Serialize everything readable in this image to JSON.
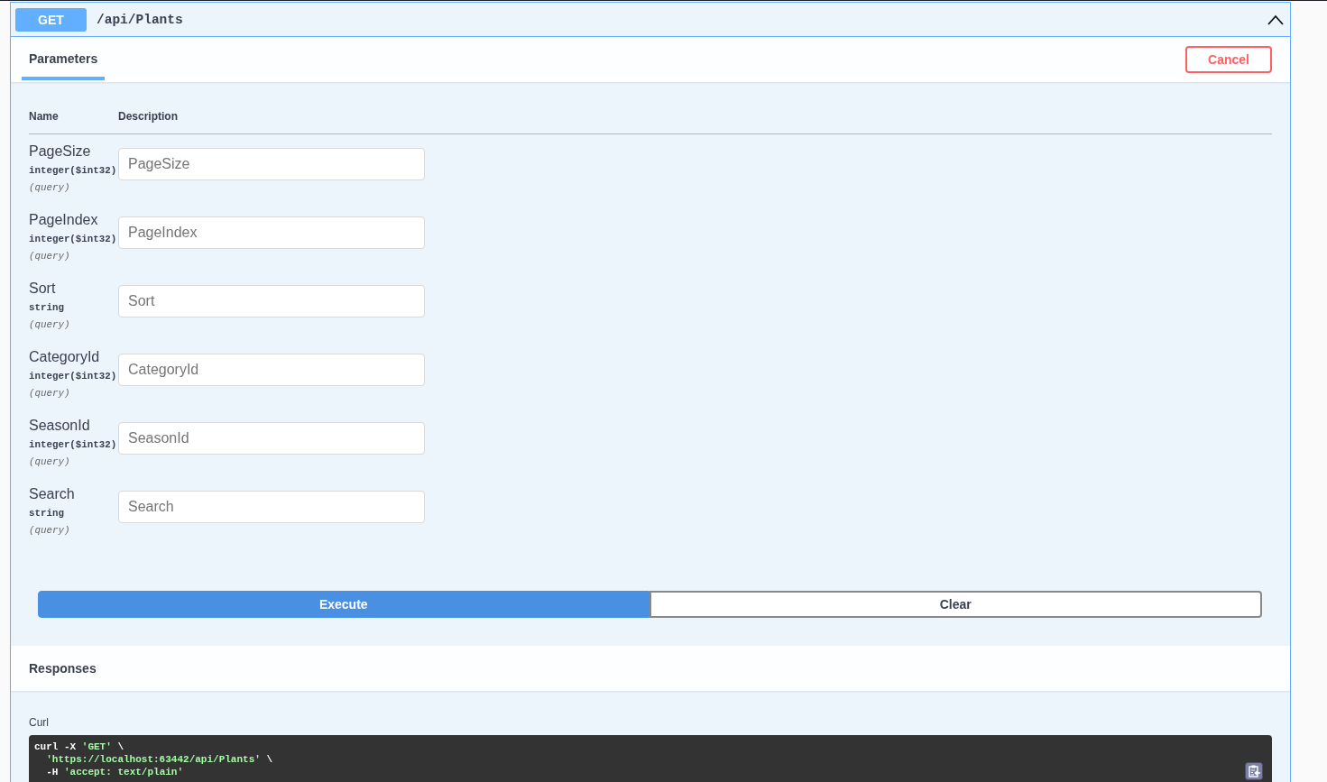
{
  "operation": {
    "method": "GET",
    "path": "/api/Plants",
    "expanded": true
  },
  "tabs": [
    {
      "label": "Parameters",
      "selected": true
    }
  ],
  "cancel_button": "Cancel",
  "parameters": {
    "columns": [
      "Name",
      "Description"
    ],
    "rows": [
      {
        "name": "PageSize",
        "type": "integer($int32)",
        "location": "(query)",
        "placeholder": "PageSize"
      },
      {
        "name": "PageIndex",
        "type": "integer($int32)",
        "location": "(query)",
        "placeholder": "PageIndex"
      },
      {
        "name": "Sort",
        "type": "string",
        "location": "(query)",
        "placeholder": "Sort"
      },
      {
        "name": "CategoryId",
        "type": "integer($int32)",
        "location": "(query)",
        "placeholder": "CategoryId"
      },
      {
        "name": "SeasonId",
        "type": "integer($int32)",
        "location": "(query)",
        "placeholder": "SeasonId"
      },
      {
        "name": "Search",
        "type": "string",
        "location": "(query)",
        "placeholder": "Search"
      }
    ]
  },
  "actions": [
    {
      "label": "Execute",
      "kind": "primary"
    },
    {
      "label": "Clear",
      "kind": "secondary"
    }
  ],
  "responses": {
    "title": "Responses",
    "curl": {
      "label": "Curl",
      "lines": [
        [
          {
            "text": "curl -X ",
            "kind": "plain"
          },
          {
            "text": "'GET'",
            "kind": "string"
          },
          {
            "text": " \\",
            "kind": "plain"
          }
        ],
        [
          {
            "text": "  'https://localhost:63442/api/Plants'",
            "kind": "string"
          },
          {
            "text": " \\",
            "kind": "plain"
          }
        ],
        [
          {
            "text": "  -H ",
            "kind": "plain"
          },
          {
            "text": "'accept: text/plain'",
            "kind": "string"
          }
        ]
      ]
    }
  }
}
